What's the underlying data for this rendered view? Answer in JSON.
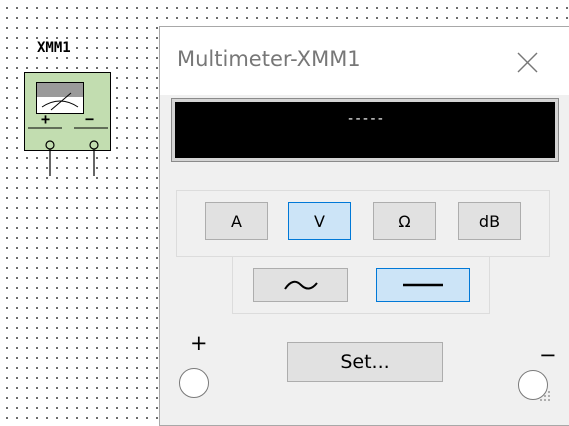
{
  "schematic": {
    "instrument_label": "XMM1",
    "plus_sign": "+",
    "minus_sign": "−",
    "fill_color": "#c2ddb0"
  },
  "multimeter": {
    "title": "Multimeter-XMM1",
    "close_icon": "close-icon",
    "display_value": "-----",
    "mode_buttons": [
      {
        "label": "A",
        "active": false
      },
      {
        "label": "V",
        "active": true
      },
      {
        "label": "Ω",
        "active": false
      },
      {
        "label": "dB",
        "active": false
      }
    ],
    "signal_buttons": [
      {
        "icon": "ac-wave-icon",
        "active": false
      },
      {
        "icon": "dc-line-icon",
        "active": true
      }
    ],
    "set_label": "Set...",
    "plus_terminal_label": "+",
    "minus_terminal_label": "−",
    "colors": {
      "active_fill": "#cce4f7",
      "active_border": "#0078d7",
      "display_bg": "#000000"
    }
  }
}
